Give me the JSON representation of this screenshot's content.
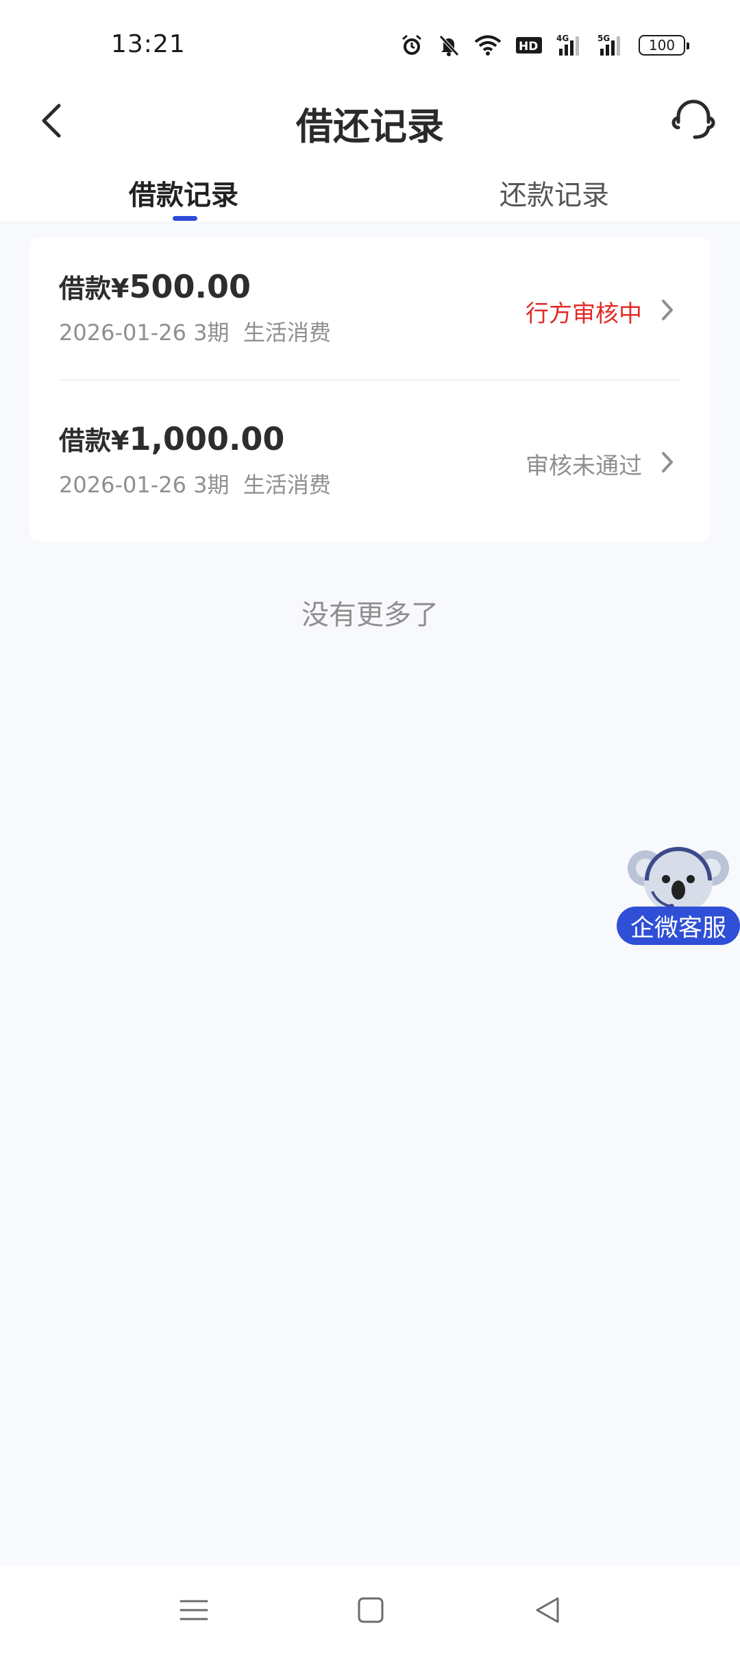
{
  "status_bar": {
    "time": "13:21",
    "icons": [
      "alarm-icon",
      "mute-icon",
      "wifi-icon",
      "hd-icon",
      "signal-4g-icon",
      "signal-5g-icon",
      "battery-icon"
    ],
    "battery": "100"
  },
  "nav": {
    "title": "借还记录",
    "back_icon": "back-arrow-icon",
    "support_icon": "headset-icon"
  },
  "tabs": [
    {
      "label": "借款记录",
      "active": true
    },
    {
      "label": "还款记录",
      "active": false
    }
  ],
  "colors": {
    "accent": "#2f4bd8",
    "status_red": "#e12b28",
    "muted": "#8f8f8f",
    "background": "#f8f9fd"
  },
  "records": [
    {
      "amount_label": "借款¥",
      "amount_value": "500.00",
      "meta": "2026-01-26 3期  生活消费",
      "status": "行方审核中",
      "status_color": "#e12b28"
    },
    {
      "amount_label": "借款¥",
      "amount_value": "1,000.00",
      "meta": "2026-01-26 3期  生活消费",
      "status": "审核未通过",
      "status_color": "#8f8f8f"
    }
  ],
  "list_end": "没有更多了",
  "floating_service": {
    "label": "企微客服",
    "icon": "koala-mascot-icon"
  },
  "system_nav": [
    "menu-icon",
    "home-icon",
    "back-triangle-icon"
  ]
}
